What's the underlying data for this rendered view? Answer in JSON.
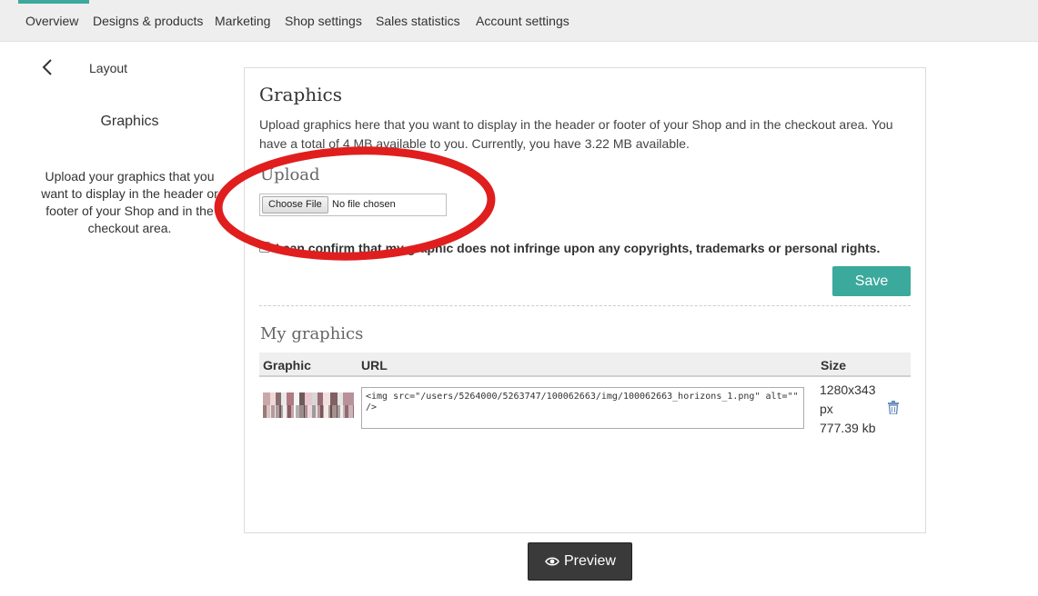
{
  "nav": {
    "items": [
      {
        "label": "Overview",
        "active": true
      },
      {
        "label": "Designs & products"
      },
      {
        "label": "Marketing"
      },
      {
        "label": "Shop settings"
      },
      {
        "label": "Sales statistics"
      },
      {
        "label": "Account settings"
      }
    ],
    "accent_color": "#3ba99c"
  },
  "sidebar": {
    "back_icon": "chevron-left-icon",
    "title": "Layout",
    "heading": "Graphics",
    "description": "Upload your graphics that you want to display in the header or footer of your Shop and in the checkout area."
  },
  "panel": {
    "title": "Graphics",
    "intro": "Upload graphics here that you want to display in the header or footer of your Shop and in the checkout area. You have a total of 4 MB available to you. Currently, you have 3.22 MB available.",
    "upload": {
      "title": "Upload",
      "choose_label": "Choose File",
      "status": "No file chosen"
    },
    "confirm_label": "I can confirm that my graphic does not infringe upon any copyrights, trademarks or personal rights.",
    "save_label": "Save",
    "my_graphics": {
      "title": "My graphics",
      "columns": [
        "Graphic",
        "URL",
        "Size"
      ],
      "rows": [
        {
          "url": "<img src=\"/users/5264000/5263747/100062663/img/100062663_horizons_1.png\" alt=\"\" />",
          "size_dims": "1280x343",
          "size_unit": "px",
          "size_kb": "777.39 kb",
          "delete_icon": "trash-icon"
        }
      ]
    }
  },
  "preview_label": "Preview",
  "preview_icon": "eye-icon",
  "annotation_color": "#e01e1e"
}
